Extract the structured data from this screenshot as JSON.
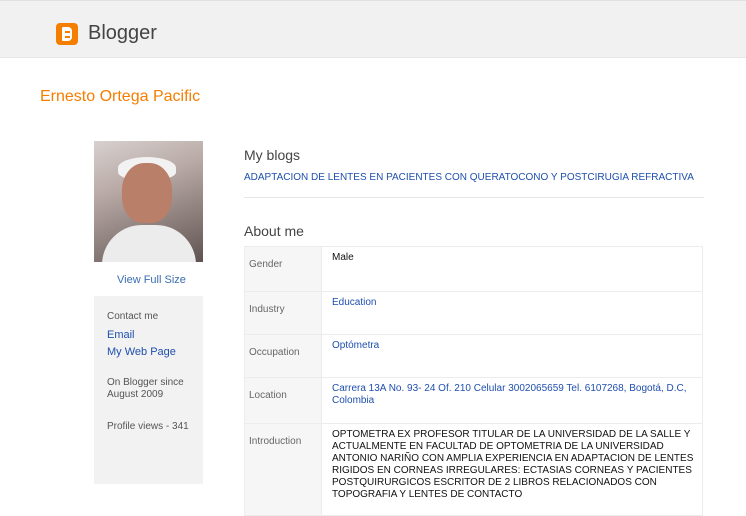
{
  "header": {
    "brand": "Blogger",
    "logo_icon": "blogger-logo-icon",
    "brand_color": "#f57d00"
  },
  "profile": {
    "name": "Ernesto Ortega Pacific",
    "photo_link": "View Full Size",
    "contact_label": "Contact me",
    "email_link": "Email",
    "webpage_link": "My Web Page",
    "since_label": "On Blogger since",
    "since_date": "August 2009",
    "profile_views": "Profile views - 341"
  },
  "my_blogs": {
    "title": "My blogs",
    "blog_link": "ADAPTACION DE LENTES EN PACIENTES CON QUERATOCONO Y POSTCIRUGIA REFRACTIVA"
  },
  "about": {
    "title": "About me",
    "rows": [
      {
        "label": "Gender",
        "value": "Male"
      },
      {
        "label": "Industry",
        "value": "Education"
      },
      {
        "label": "Occupation",
        "value": "Optómetra"
      },
      {
        "label": "Location",
        "value_line1": "Carrera 13A No. 93- 24 Of. 210 Celular 3002065659 Tel. 6107268, Bogotá, D.C,",
        "value_line2": "Colombia"
      },
      {
        "label": "Introduction",
        "value_lines": [
          "OPTOMETRA EX PROFESOR TITULAR DE LA UNIVERSIDAD DE LA SALLE Y",
          "ACTUALMENTE EN FACULTAD DE OPTOMETRIA DE LA UNIVERSIDAD",
          "ANTONIO NARIÑO CON AMPLIA EXPERIENCIA EN ADAPTACION DE LENTES",
          "RIGIDOS EN CORNEAS IRREGULARES: ECTASIAS CORNEAS Y PACIENTES",
          "POSTQUIRURGICOS ESCRITOR DE 2 LIBROS RELACIONADOS CON",
          "TOPOGRAFIA Y LENTES DE CONTACTO"
        ]
      }
    ]
  }
}
